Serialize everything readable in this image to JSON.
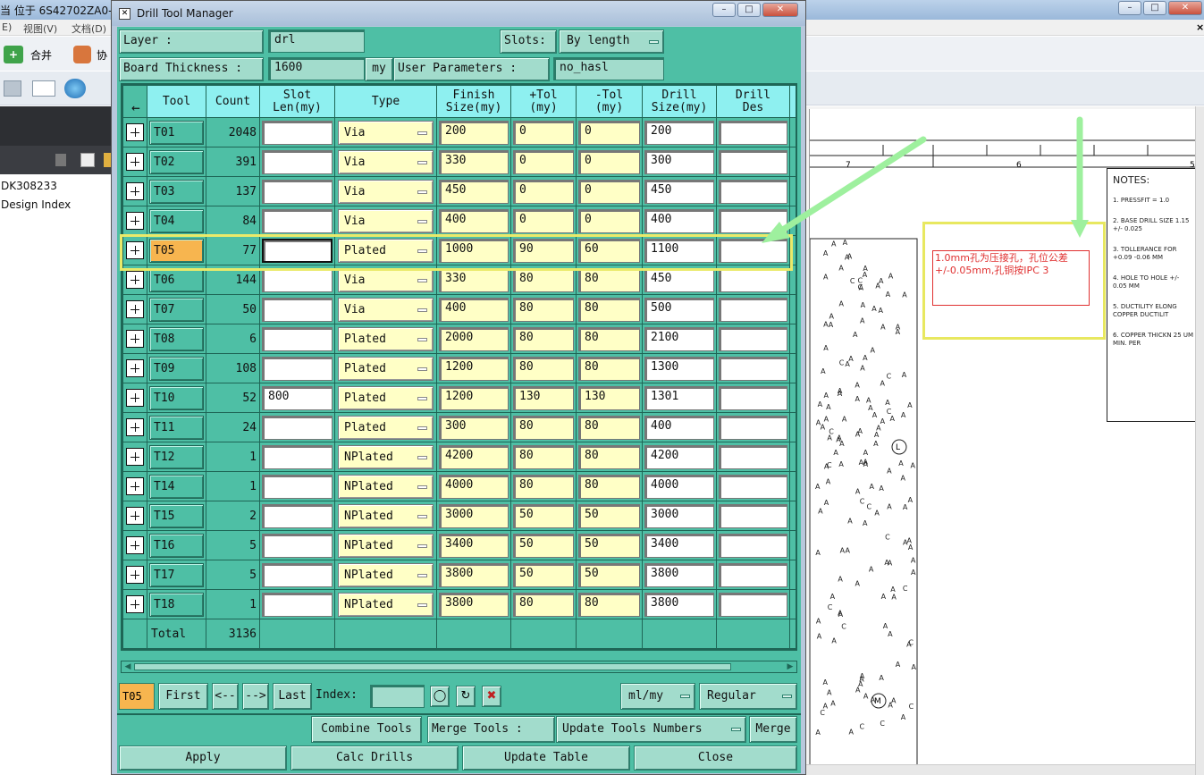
{
  "background_app": {
    "title_fragment": "当 位于 6S42702ZA0-",
    "menu": [
      "E)",
      "视图(V)",
      "文档(D)"
    ],
    "merge_label": "合并",
    "collab_label": "协",
    "left_items": [
      "DK308233",
      "Design Index"
    ],
    "drawing_cols": [
      "7",
      "6",
      "5"
    ],
    "notes_title": "NOTES:",
    "notes": [
      "1. PRESSFIT = 1.0",
      "2. BASE DRILL SIZE 1.15 +/- 0.025",
      "3. TOLLERANCE FOR +0.09 -0.06 MM",
      "4. HOLE TO HOLE +/- 0.05 MM",
      "5. DUCTILITY ELONG COPPER DUCTILIT",
      "6. COPPER THICKN 25 UM MIN. PER"
    ],
    "annotation": "1.0mm孔为压接孔，孔位公差+/-0.05mm,孔铜按IPC 3",
    "marker_L": "L",
    "marker_M": "M"
  },
  "dialog": {
    "title": "Drill Tool Manager",
    "layer_label": "Layer          :",
    "layer_value": "drl",
    "slots_label": "Slots:",
    "slots_value": "By length",
    "thickness_label": "Board Thickness :",
    "thickness_value": "1600",
    "thickness_unit": "my",
    "user_params_label": "User Parameters :",
    "user_params_value": "no_hasl",
    "columns": [
      "Tool",
      "Count",
      "Slot Len(my)",
      "Type",
      "Finish Size(my)",
      "+Tol (my)",
      "-Tol (my)",
      "Drill Size(my)",
      "Drill Des"
    ],
    "rows": [
      {
        "tool": "T01",
        "count": "2048",
        "slot": "",
        "type": "Via",
        "finish": "200",
        "ptol": "0",
        "mtol": "0",
        "drill": "200",
        "des": ""
      },
      {
        "tool": "T02",
        "count": "391",
        "slot": "",
        "type": "Via",
        "finish": "330",
        "ptol": "0",
        "mtol": "0",
        "drill": "300",
        "des": ""
      },
      {
        "tool": "T03",
        "count": "137",
        "slot": "",
        "type": "Via",
        "finish": "450",
        "ptol": "0",
        "mtol": "0",
        "drill": "450",
        "des": ""
      },
      {
        "tool": "T04",
        "count": "84",
        "slot": "",
        "type": "Via",
        "finish": "400",
        "ptol": "0",
        "mtol": "0",
        "drill": "400",
        "des": ""
      },
      {
        "tool": "T05",
        "count": "77",
        "slot": "",
        "type": "Plated",
        "finish": "1000",
        "ptol": "90",
        "mtol": "60",
        "drill": "1100",
        "des": "",
        "selected": true
      },
      {
        "tool": "T06",
        "count": "144",
        "slot": "",
        "type": "Via",
        "finish": "330",
        "ptol": "80",
        "mtol": "80",
        "drill": "450",
        "des": ""
      },
      {
        "tool": "T07",
        "count": "50",
        "slot": "",
        "type": "Via",
        "finish": "400",
        "ptol": "80",
        "mtol": "80",
        "drill": "500",
        "des": ""
      },
      {
        "tool": "T08",
        "count": "6",
        "slot": "",
        "type": "Plated",
        "finish": "2000",
        "ptol": "80",
        "mtol": "80",
        "drill": "2100",
        "des": ""
      },
      {
        "tool": "T09",
        "count": "108",
        "slot": "",
        "type": "Plated",
        "finish": "1200",
        "ptol": "80",
        "mtol": "80",
        "drill": "1300",
        "des": ""
      },
      {
        "tool": "T10",
        "count": "52",
        "slot": "800",
        "type": "Plated",
        "finish": "1200",
        "ptol": "130",
        "mtol": "130",
        "drill": "1301",
        "des": ""
      },
      {
        "tool": "T11",
        "count": "24",
        "slot": "",
        "type": "Plated",
        "finish": "300",
        "ptol": "80",
        "mtol": "80",
        "drill": "400",
        "des": ""
      },
      {
        "tool": "T12",
        "count": "1",
        "slot": "",
        "type": "NPlated",
        "finish": "4200",
        "ptol": "80",
        "mtol": "80",
        "drill": "4200",
        "des": ""
      },
      {
        "tool": "T14",
        "count": "1",
        "slot": "",
        "type": "NPlated",
        "finish": "4000",
        "ptol": "80",
        "mtol": "80",
        "drill": "4000",
        "des": ""
      },
      {
        "tool": "T15",
        "count": "2",
        "slot": "",
        "type": "NPlated",
        "finish": "3000",
        "ptol": "50",
        "mtol": "50",
        "drill": "3000",
        "des": ""
      },
      {
        "tool": "T16",
        "count": "5",
        "slot": "",
        "type": "NPlated",
        "finish": "3400",
        "ptol": "50",
        "mtol": "50",
        "drill": "3400",
        "des": ""
      },
      {
        "tool": "T17",
        "count": "5",
        "slot": "",
        "type": "NPlated",
        "finish": "3800",
        "ptol": "50",
        "mtol": "50",
        "drill": "3800",
        "des": ""
      },
      {
        "tool": "T18",
        "count": "1",
        "slot": "",
        "type": "NPlated",
        "finish": "3800",
        "ptol": "80",
        "mtol": "80",
        "drill": "3800",
        "des": ""
      }
    ],
    "total_label": "Total",
    "total_value": "3136",
    "nav": {
      "current": "T05",
      "first": "First",
      "prev": "<--",
      "next": "-->",
      "last": "Last",
      "index_label": "Index:",
      "units": "ml/my",
      "mode": "Regular"
    },
    "actions": {
      "combine": "Combine Tools",
      "merge_label": "Merge Tools :",
      "merge_mode": "Update Tools Numbers",
      "merge": "Merge"
    },
    "footer": {
      "apply": "Apply",
      "calc": "Calc Drills",
      "update": "Update Table",
      "close": "Close"
    }
  },
  "colors": {
    "dialog_bg": "#4ebfa5",
    "header_cyan": "#8ef0f0",
    "yellow_field": "#ffffc6",
    "selected_tool": "#f7b54f",
    "highlight": "#eaea6a",
    "arrow": "#9ef09e",
    "annotation_red": "#e03030"
  }
}
